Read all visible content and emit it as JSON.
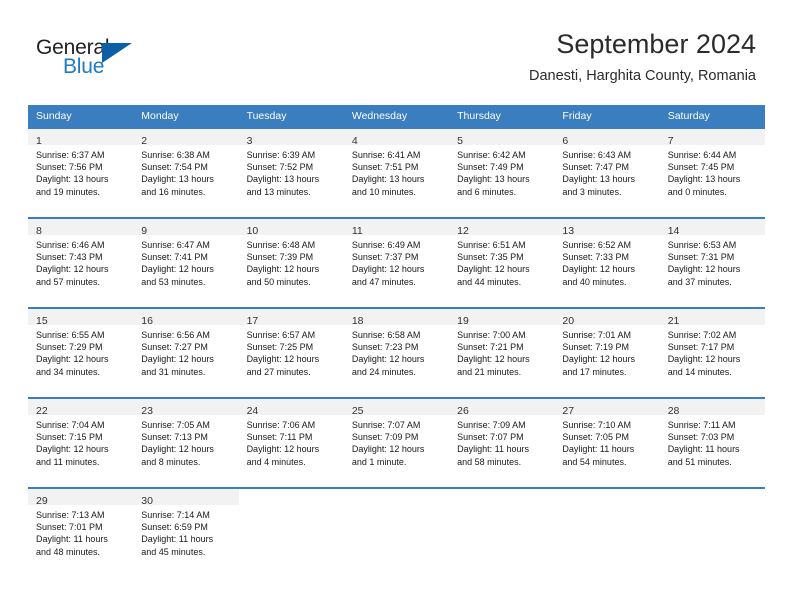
{
  "logo": {
    "word_top": "General",
    "word_bottom": "Blue",
    "blue": "#1f7ac4",
    "dark": "#231f20",
    "triangle": "#0b5fa5"
  },
  "header": {
    "title": "September 2024",
    "subtitle": "Danesti, Harghita County, Romania"
  },
  "colors": {
    "header_row_bg": "#3a7ebf",
    "daynum_band_bg": "#f2f2f2",
    "row_divider": "#3a7ebf"
  },
  "weekdays": [
    "Sunday",
    "Monday",
    "Tuesday",
    "Wednesday",
    "Thursday",
    "Friday",
    "Saturday"
  ],
  "weeks": [
    [
      {
        "day": "1",
        "sunrise": "Sunrise: 6:37 AM",
        "sunset": "Sunset: 7:56 PM",
        "daylight_l1": "Daylight: 13 hours",
        "daylight_l2": "and 19 minutes."
      },
      {
        "day": "2",
        "sunrise": "Sunrise: 6:38 AM",
        "sunset": "Sunset: 7:54 PM",
        "daylight_l1": "Daylight: 13 hours",
        "daylight_l2": "and 16 minutes."
      },
      {
        "day": "3",
        "sunrise": "Sunrise: 6:39 AM",
        "sunset": "Sunset: 7:52 PM",
        "daylight_l1": "Daylight: 13 hours",
        "daylight_l2": "and 13 minutes."
      },
      {
        "day": "4",
        "sunrise": "Sunrise: 6:41 AM",
        "sunset": "Sunset: 7:51 PM",
        "daylight_l1": "Daylight: 13 hours",
        "daylight_l2": "and 10 minutes."
      },
      {
        "day": "5",
        "sunrise": "Sunrise: 6:42 AM",
        "sunset": "Sunset: 7:49 PM",
        "daylight_l1": "Daylight: 13 hours",
        "daylight_l2": "and 6 minutes."
      },
      {
        "day": "6",
        "sunrise": "Sunrise: 6:43 AM",
        "sunset": "Sunset: 7:47 PM",
        "daylight_l1": "Daylight: 13 hours",
        "daylight_l2": "and 3 minutes."
      },
      {
        "day": "7",
        "sunrise": "Sunrise: 6:44 AM",
        "sunset": "Sunset: 7:45 PM",
        "daylight_l1": "Daylight: 13 hours",
        "daylight_l2": "and 0 minutes."
      }
    ],
    [
      {
        "day": "8",
        "sunrise": "Sunrise: 6:46 AM",
        "sunset": "Sunset: 7:43 PM",
        "daylight_l1": "Daylight: 12 hours",
        "daylight_l2": "and 57 minutes."
      },
      {
        "day": "9",
        "sunrise": "Sunrise: 6:47 AM",
        "sunset": "Sunset: 7:41 PM",
        "daylight_l1": "Daylight: 12 hours",
        "daylight_l2": "and 53 minutes."
      },
      {
        "day": "10",
        "sunrise": "Sunrise: 6:48 AM",
        "sunset": "Sunset: 7:39 PM",
        "daylight_l1": "Daylight: 12 hours",
        "daylight_l2": "and 50 minutes."
      },
      {
        "day": "11",
        "sunrise": "Sunrise: 6:49 AM",
        "sunset": "Sunset: 7:37 PM",
        "daylight_l1": "Daylight: 12 hours",
        "daylight_l2": "and 47 minutes."
      },
      {
        "day": "12",
        "sunrise": "Sunrise: 6:51 AM",
        "sunset": "Sunset: 7:35 PM",
        "daylight_l1": "Daylight: 12 hours",
        "daylight_l2": "and 44 minutes."
      },
      {
        "day": "13",
        "sunrise": "Sunrise: 6:52 AM",
        "sunset": "Sunset: 7:33 PM",
        "daylight_l1": "Daylight: 12 hours",
        "daylight_l2": "and 40 minutes."
      },
      {
        "day": "14",
        "sunrise": "Sunrise: 6:53 AM",
        "sunset": "Sunset: 7:31 PM",
        "daylight_l1": "Daylight: 12 hours",
        "daylight_l2": "and 37 minutes."
      }
    ],
    [
      {
        "day": "15",
        "sunrise": "Sunrise: 6:55 AM",
        "sunset": "Sunset: 7:29 PM",
        "daylight_l1": "Daylight: 12 hours",
        "daylight_l2": "and 34 minutes."
      },
      {
        "day": "16",
        "sunrise": "Sunrise: 6:56 AM",
        "sunset": "Sunset: 7:27 PM",
        "daylight_l1": "Daylight: 12 hours",
        "daylight_l2": "and 31 minutes."
      },
      {
        "day": "17",
        "sunrise": "Sunrise: 6:57 AM",
        "sunset": "Sunset: 7:25 PM",
        "daylight_l1": "Daylight: 12 hours",
        "daylight_l2": "and 27 minutes."
      },
      {
        "day": "18",
        "sunrise": "Sunrise: 6:58 AM",
        "sunset": "Sunset: 7:23 PM",
        "daylight_l1": "Daylight: 12 hours",
        "daylight_l2": "and 24 minutes."
      },
      {
        "day": "19",
        "sunrise": "Sunrise: 7:00 AM",
        "sunset": "Sunset: 7:21 PM",
        "daylight_l1": "Daylight: 12 hours",
        "daylight_l2": "and 21 minutes."
      },
      {
        "day": "20",
        "sunrise": "Sunrise: 7:01 AM",
        "sunset": "Sunset: 7:19 PM",
        "daylight_l1": "Daylight: 12 hours",
        "daylight_l2": "and 17 minutes."
      },
      {
        "day": "21",
        "sunrise": "Sunrise: 7:02 AM",
        "sunset": "Sunset: 7:17 PM",
        "daylight_l1": "Daylight: 12 hours",
        "daylight_l2": "and 14 minutes."
      }
    ],
    [
      {
        "day": "22",
        "sunrise": "Sunrise: 7:04 AM",
        "sunset": "Sunset: 7:15 PM",
        "daylight_l1": "Daylight: 12 hours",
        "daylight_l2": "and 11 minutes."
      },
      {
        "day": "23",
        "sunrise": "Sunrise: 7:05 AM",
        "sunset": "Sunset: 7:13 PM",
        "daylight_l1": "Daylight: 12 hours",
        "daylight_l2": "and 8 minutes."
      },
      {
        "day": "24",
        "sunrise": "Sunrise: 7:06 AM",
        "sunset": "Sunset: 7:11 PM",
        "daylight_l1": "Daylight: 12 hours",
        "daylight_l2": "and 4 minutes."
      },
      {
        "day": "25",
        "sunrise": "Sunrise: 7:07 AM",
        "sunset": "Sunset: 7:09 PM",
        "daylight_l1": "Daylight: 12 hours",
        "daylight_l2": "and 1 minute."
      },
      {
        "day": "26",
        "sunrise": "Sunrise: 7:09 AM",
        "sunset": "Sunset: 7:07 PM",
        "daylight_l1": "Daylight: 11 hours",
        "daylight_l2": "and 58 minutes."
      },
      {
        "day": "27",
        "sunrise": "Sunrise: 7:10 AM",
        "sunset": "Sunset: 7:05 PM",
        "daylight_l1": "Daylight: 11 hours",
        "daylight_l2": "and 54 minutes."
      },
      {
        "day": "28",
        "sunrise": "Sunrise: 7:11 AM",
        "sunset": "Sunset: 7:03 PM",
        "daylight_l1": "Daylight: 11 hours",
        "daylight_l2": "and 51 minutes."
      }
    ],
    [
      {
        "day": "29",
        "sunrise": "Sunrise: 7:13 AM",
        "sunset": "Sunset: 7:01 PM",
        "daylight_l1": "Daylight: 11 hours",
        "daylight_l2": "and 48 minutes."
      },
      {
        "day": "30",
        "sunrise": "Sunrise: 7:14 AM",
        "sunset": "Sunset: 6:59 PM",
        "daylight_l1": "Daylight: 11 hours",
        "daylight_l2": "and 45 minutes."
      },
      {
        "day": "",
        "sunrise": "",
        "sunset": "",
        "daylight_l1": "",
        "daylight_l2": ""
      },
      {
        "day": "",
        "sunrise": "",
        "sunset": "",
        "daylight_l1": "",
        "daylight_l2": ""
      },
      {
        "day": "",
        "sunrise": "",
        "sunset": "",
        "daylight_l1": "",
        "daylight_l2": ""
      },
      {
        "day": "",
        "sunrise": "",
        "sunset": "",
        "daylight_l1": "",
        "daylight_l2": ""
      },
      {
        "day": "",
        "sunrise": "",
        "sunset": "",
        "daylight_l1": "",
        "daylight_l2": ""
      }
    ]
  ]
}
